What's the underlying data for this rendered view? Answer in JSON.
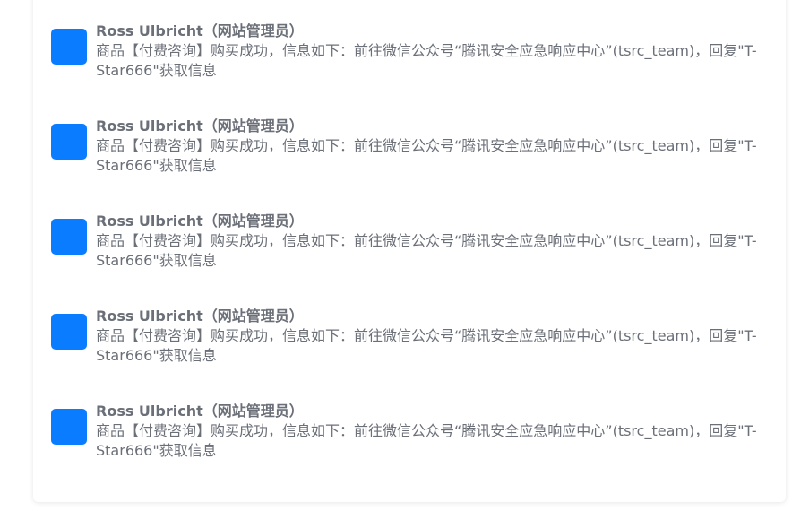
{
  "colors": {
    "avatar": "#0a7cff",
    "text": "#6b6f78"
  },
  "messages": [
    {
      "author": "Ross Ulbricht（网站管理员）",
      "body": "商品【付费咨询】购买成功，信息如下：前往微信公众号“腾讯安全应急响应中心”(tsrc_team)，回复\"T-Star666\"获取信息"
    },
    {
      "author": "Ross Ulbricht（网站管理员）",
      "body": "商品【付费咨询】购买成功，信息如下：前往微信公众号“腾讯安全应急响应中心”(tsrc_team)，回复\"T-Star666\"获取信息"
    },
    {
      "author": "Ross Ulbricht（网站管理员）",
      "body": "商品【付费咨询】购买成功，信息如下：前往微信公众号“腾讯安全应急响应中心”(tsrc_team)，回复\"T-Star666\"获取信息"
    },
    {
      "author": "Ross Ulbricht（网站管理员）",
      "body": "商品【付费咨询】购买成功，信息如下：前往微信公众号“腾讯安全应急响应中心”(tsrc_team)，回复\"T-Star666\"获取信息"
    },
    {
      "author": "Ross Ulbricht（网站管理员）",
      "body": "商品【付费咨询】购买成功，信息如下：前往微信公众号“腾讯安全应急响应中心”(tsrc_team)，回复\"T-Star666\"获取信息"
    }
  ]
}
